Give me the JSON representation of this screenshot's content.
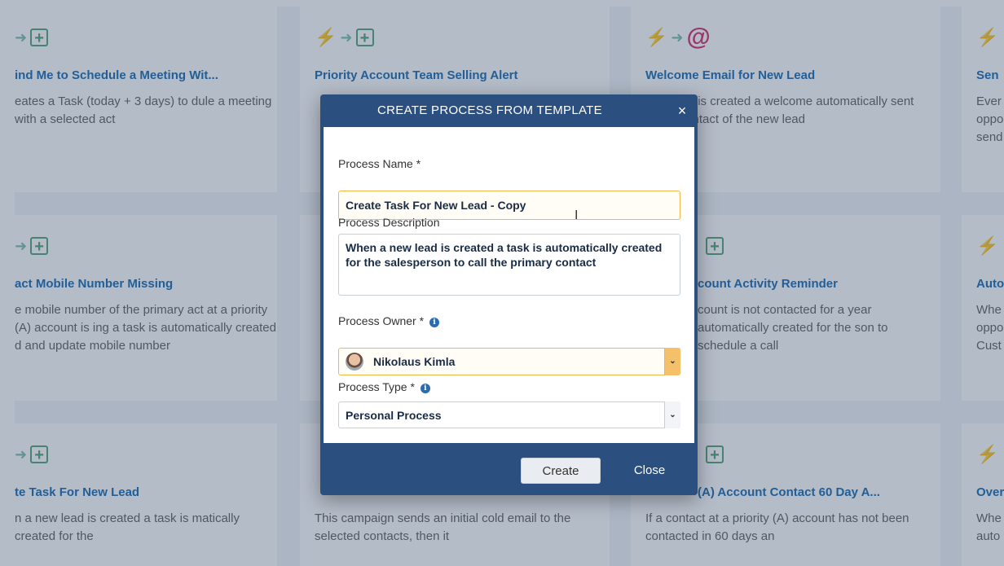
{
  "cards": [
    {
      "title": "ind Me to Schedule a Meeting Wit...",
      "desc": "eates a Task (today + 3 days) to dule a meeting with a selected act",
      "icons": [
        "arrow-icon",
        "plus-box-icon"
      ]
    },
    {
      "title": "Priority Account Team Selling Alert",
      "desc": "",
      "icons": [
        "bolt-icon",
        "arrow-icon",
        "plus-box-icon"
      ]
    },
    {
      "title": "Welcome Email for New Lead",
      "desc": "new lead is created a welcome automatically sent to the contact of the new lead",
      "icons": [
        "bolt-icon",
        "arrow-icon",
        "at-icon"
      ]
    },
    {
      "title": "Sen",
      "desc": "Ever oppo send",
      "icons": [
        "bolt-icon"
      ]
    },
    {
      "title": "act Mobile Number Missing",
      "desc": "e mobile number of the primary act at a priority (A) account is ing a task is automatically created d and update mobile number",
      "icons": [
        "arrow-icon",
        "plus-box-icon"
      ]
    },
    {
      "title": "",
      "desc": "",
      "icons": []
    },
    {
      "title": "count Activity Reminder",
      "desc": "count is not contacted for a year automatically created for the son to schedule a call",
      "icons": [
        "plus-box-icon"
      ]
    },
    {
      "title": "Auto",
      "desc": "Whe oppo Cust",
      "icons": [
        "bolt-icon"
      ]
    },
    {
      "title": "te Task For New Lead",
      "desc": "n a new lead is created a task is matically created for the",
      "icons": [
        "arrow-icon",
        "plus-box-icon"
      ]
    },
    {
      "title": "",
      "desc": "This campaign sends an initial cold email to the selected contacts, then it",
      "icons": []
    },
    {
      "title": "(A) Account Contact 60 Day A...",
      "desc": "If a contact at a priority (A) account has not been contacted in 60 days an",
      "icons": [
        "plus-box-icon"
      ]
    },
    {
      "title": "Over",
      "desc": "Whe auto",
      "icons": [
        "bolt-icon"
      ]
    }
  ],
  "modal": {
    "title": "CREATE PROCESS FROM TEMPLATE",
    "close_glyph": "×",
    "name_label": "Process Name *",
    "name_value": "Create Task For New Lead - Copy",
    "desc_label": "Process Description",
    "desc_value": "When a new lead is created a task is automatically created for the salesperson to call the primary contact",
    "owner_label": "Process Owner *",
    "owner_value": "Nikolaus Kimla",
    "type_label": "Process Type *",
    "type_value": "Personal Process",
    "info_glyph": "i",
    "caret_glyph": "⌄",
    "create_label": "Create",
    "close_label": "Close"
  },
  "colors": {
    "modal_header": "#2b4f7e",
    "card_title": "#1f6fb4",
    "focus_border": "#f0b847"
  }
}
